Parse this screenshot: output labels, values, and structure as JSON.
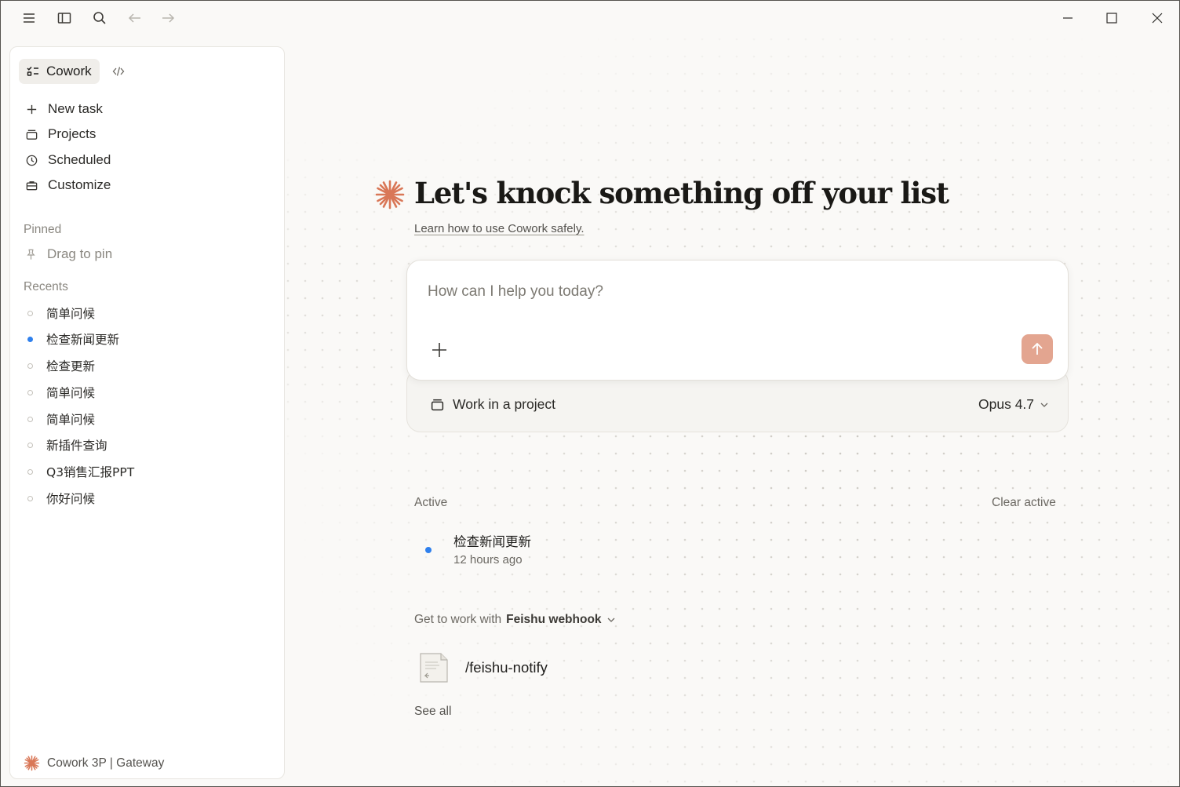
{
  "titlebar": {
    "icons": [
      "menu-icon",
      "sidebar-toggle-icon",
      "search-icon",
      "arrow-left-icon",
      "arrow-right-icon"
    ],
    "window_controls": [
      "minimize-icon",
      "maximize-icon",
      "close-icon"
    ]
  },
  "sidebar": {
    "mode_label": "Cowork",
    "nav": [
      {
        "label": "New task",
        "icon": "plus-icon"
      },
      {
        "label": "Projects",
        "icon": "folder-stack-icon"
      },
      {
        "label": "Scheduled",
        "icon": "clock-icon"
      },
      {
        "label": "Customize",
        "icon": "briefcase-icon"
      }
    ],
    "pinned_label": "Pinned",
    "pin_hint": "Drag to pin",
    "recents_label": "Recents",
    "recents": [
      {
        "label": "简单问候",
        "active": false
      },
      {
        "label": "检查新闻更新",
        "active": true
      },
      {
        "label": "检查更新",
        "active": false
      },
      {
        "label": "简单问候",
        "active": false
      },
      {
        "label": "简单问候",
        "active": false
      },
      {
        "label": "新插件查询",
        "active": false
      },
      {
        "label": "Q3销售汇报PPT",
        "active": false
      },
      {
        "label": "你好问候",
        "active": false
      }
    ],
    "footer": "Cowork 3P | Gateway"
  },
  "main": {
    "title": "Let's knock something off your list",
    "learn_link": "Learn how to use Cowork safely.",
    "composer_placeholder": "How can I help you today?",
    "project_label": "Work in a project",
    "model_label": "Opus 4.7",
    "active_label": "Active",
    "clear_active": "Clear active",
    "active_task": {
      "title": "检查新闻更新",
      "time": "12 hours ago"
    },
    "work_with_prefix": "Get to work with",
    "work_with_name": "Feishu webhook",
    "skill": "/feishu-notify",
    "see_all": "See all"
  },
  "colors": {
    "accent": "#d97757",
    "send_button": "#e3a590",
    "active_dot": "#2f80ed"
  }
}
